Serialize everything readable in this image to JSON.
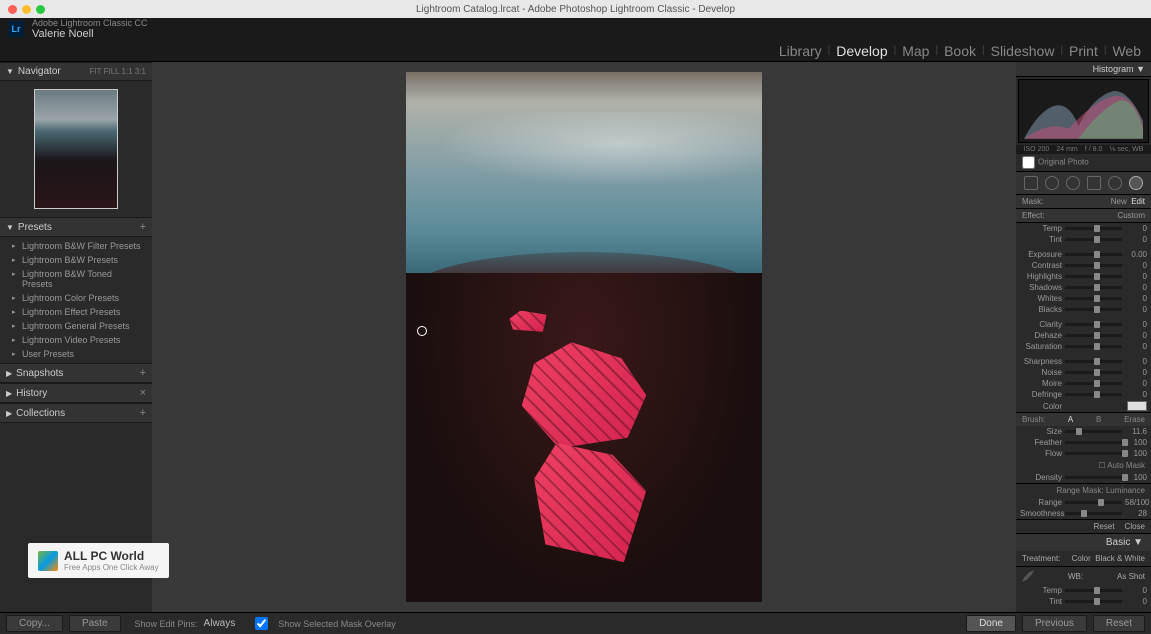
{
  "titlebar": {
    "title": "Lightroom Catalog.lrcat - Adobe Photoshop Lightroom Classic - Develop"
  },
  "identity": {
    "product": "Adobe Lightroom Classic CC",
    "user": "Valerie Noell"
  },
  "modules": [
    "Library",
    "Develop",
    "Map",
    "Book",
    "Slideshow",
    "Print",
    "Web"
  ],
  "active_module": "Develop",
  "left": {
    "navigator": {
      "title": "Navigator",
      "zoom": "FIT  FILL  1:1  3:1"
    },
    "presets": {
      "title": "Presets",
      "items": [
        "Lightroom B&W Filter Presets",
        "Lightroom B&W Presets",
        "Lightroom B&W Toned Presets",
        "Lightroom Color Presets",
        "Lightroom Effect Presets",
        "Lightroom General Presets",
        "Lightroom Video Presets",
        "User Presets"
      ]
    },
    "snapshots": "Snapshots",
    "history": "History",
    "collections": "Collections"
  },
  "watermark": {
    "title": "ALL PC World",
    "sub": "Free Apps One Click Away"
  },
  "right": {
    "histogram": "Histogram",
    "meta": {
      "iso": "ISO 200",
      "focal": "24 mm",
      "aperture": "f / 8.0",
      "shutter": "⅛ sec, WB"
    },
    "original": "Original Photo",
    "mask_bar": {
      "label": "Mask:",
      "new": "New",
      "edit": "Edit"
    },
    "effect": {
      "label": "Effect:",
      "value": "Custom"
    },
    "sliders_tone": [
      {
        "name": "Temp",
        "val": "0",
        "pos": 50
      },
      {
        "name": "Tint",
        "val": "0",
        "pos": 50
      }
    ],
    "sliders_exp": [
      {
        "name": "Exposure",
        "val": "0.00",
        "pos": 50
      },
      {
        "name": "Contrast",
        "val": "0",
        "pos": 50
      },
      {
        "name": "Highlights",
        "val": "0",
        "pos": 50
      },
      {
        "name": "Shadows",
        "val": "0",
        "pos": 50
      },
      {
        "name": "Whites",
        "val": "0",
        "pos": 50
      },
      {
        "name": "Blacks",
        "val": "0",
        "pos": 50
      }
    ],
    "sliders_clarity": [
      {
        "name": "Clarity",
        "val": "0",
        "pos": 50
      },
      {
        "name": "Dehaze",
        "val": "0",
        "pos": 50
      },
      {
        "name": "Saturation",
        "val": "0",
        "pos": 50
      }
    ],
    "sliders_detail": [
      {
        "name": "Sharpness",
        "val": "0",
        "pos": 50
      },
      {
        "name": "Noise",
        "val": "0",
        "pos": 50
      },
      {
        "name": "Moire",
        "val": "0",
        "pos": 50
      },
      {
        "name": "Defringe",
        "val": "0",
        "pos": 50
      }
    ],
    "color_label": "Color",
    "brush": {
      "label": "Brush:",
      "a": "A",
      "b": "B",
      "erase": "Erase"
    },
    "brush_sliders": [
      {
        "name": "Size",
        "val": "11.6",
        "pos": 20
      },
      {
        "name": "Feather",
        "val": "100",
        "pos": 100
      },
      {
        "name": "Flow",
        "val": "100",
        "pos": 100
      }
    ],
    "auto_mask": "Auto Mask",
    "density": {
      "name": "Density",
      "val": "100",
      "pos": 100
    },
    "range_mask": {
      "label": "Range Mask:",
      "value": "Luminance"
    },
    "range_sliders": [
      {
        "name": "Range",
        "val": "58/100",
        "pos": 58
      },
      {
        "name": "Smoothness",
        "val": "28",
        "pos": 28
      }
    ],
    "reset": "Reset",
    "close": "Close",
    "basic": "Basic",
    "treatment": {
      "label": "Treatment:",
      "color": "Color",
      "bw": "Black & White"
    },
    "wb": {
      "label": "WB:",
      "value": "As Shot"
    },
    "basic_sliders": [
      {
        "name": "Temp",
        "val": "0",
        "pos": 50
      },
      {
        "name": "Tint",
        "val": "0",
        "pos": 50
      }
    ]
  },
  "bottom": {
    "copy": "Copy...",
    "paste": "Paste",
    "show_pins": "Show Edit Pins:",
    "pins_val": "Always",
    "overlay": "Show Selected Mask Overlay",
    "done": "Done",
    "previous": "Previous",
    "reset": "Reset"
  }
}
